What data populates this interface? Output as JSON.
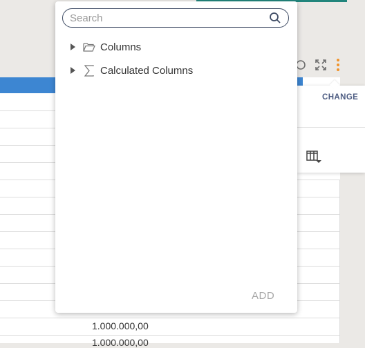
{
  "popup": {
    "search": {
      "placeholder": "Search",
      "value": ""
    },
    "tree": [
      {
        "label": "Columns",
        "icon": "folder-icon",
        "expanded": false
      },
      {
        "label": "Calculated Columns",
        "icon": "sigma-icon",
        "expanded": false
      }
    ],
    "add_label": "ADD"
  },
  "side_panel": {
    "change_label": "CHANGE"
  },
  "table": {
    "values": [
      "1.000.000,00",
      "1.000.000,00"
    ]
  },
  "colors": {
    "accent_teal": "#21857c",
    "header_blue": "#3d86d2",
    "menu_orange": "#f0932b",
    "link_navy": "#4d5c82"
  }
}
